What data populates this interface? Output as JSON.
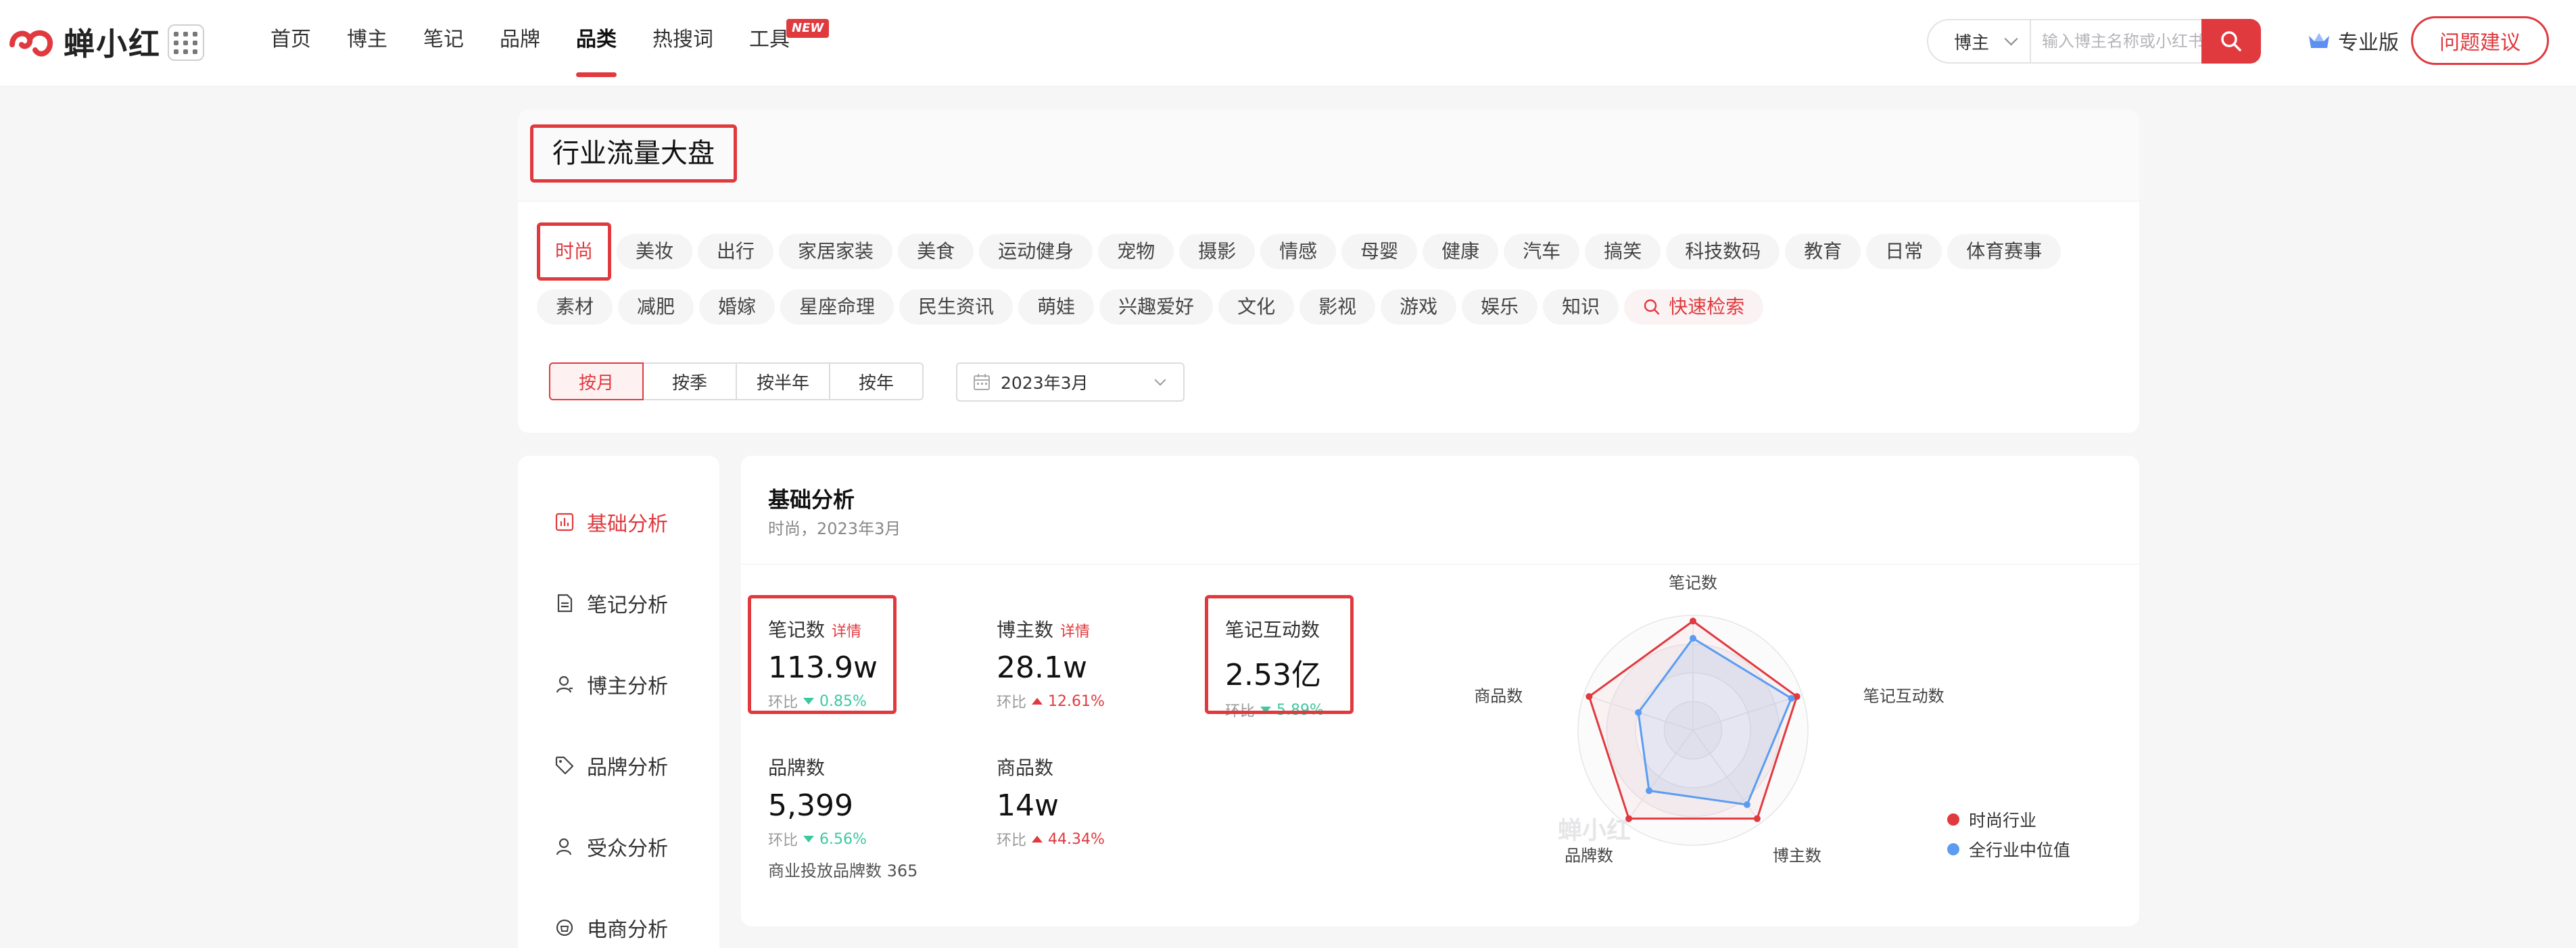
{
  "brand": {
    "name": "蝉小红"
  },
  "nav": [
    {
      "label": "首页"
    },
    {
      "label": "博主"
    },
    {
      "label": "笔记"
    },
    {
      "label": "品牌"
    },
    {
      "label": "品类"
    },
    {
      "label": "热搜词"
    },
    {
      "label": "工具"
    }
  ],
  "nav_badge": "NEW",
  "search": {
    "select_value": "博主",
    "placeholder": "输入博主名称或小红书号"
  },
  "pro_label": "专业版",
  "feedback_label": "问题建议",
  "page_title": "行业流量大盘",
  "categories_row1": [
    "时尚",
    "美妆",
    "出行",
    "家居家装",
    "美食",
    "运动健身",
    "宠物",
    "摄影",
    "情感",
    "母婴",
    "健康",
    "汽车",
    "搞笑",
    "科技数码",
    "教育",
    "日常",
    "体育赛事"
  ],
  "categories_row2": [
    "素材",
    "减肥",
    "婚嫁",
    "星座命理",
    "民生资讯",
    "萌娃",
    "兴趣爱好",
    "文化",
    "影视",
    "游戏",
    "娱乐",
    "知识"
  ],
  "quick_search_label": "快速检索",
  "period_tabs": [
    "按月",
    "按季",
    "按半年",
    "按年"
  ],
  "date_value": "2023年3月",
  "sidebar": [
    {
      "label": "基础分析",
      "icon": "bar-chart-icon"
    },
    {
      "label": "笔记分析",
      "icon": "document-icon"
    },
    {
      "label": "博主分析",
      "icon": "user-icon"
    },
    {
      "label": "品牌分析",
      "icon": "tag-icon"
    },
    {
      "label": "受众分析",
      "icon": "audience-icon"
    },
    {
      "label": "电商分析",
      "icon": "shop-icon"
    }
  ],
  "main": {
    "title": "基础分析",
    "subtitle": "时尚，2023年3月"
  },
  "stats": [
    {
      "label": "笔记数",
      "detail": "详情",
      "value": "113.9w",
      "change_prefix": "环比",
      "change": "0.85%",
      "direction": "down"
    },
    {
      "label": "博主数",
      "detail": "详情",
      "value": "28.1w",
      "change_prefix": "环比",
      "change": "12.61%",
      "direction": "up"
    },
    {
      "label": "笔记互动数",
      "detail": "",
      "value": "2.53亿",
      "change_prefix": "环比",
      "change": "5.89%",
      "direction": "down"
    },
    {
      "label": "品牌数",
      "detail": "",
      "value": "5,399",
      "change_prefix": "环比",
      "change": "6.56%",
      "direction": "down"
    },
    {
      "label": "商品数",
      "detail": "",
      "value": "14w",
      "change_prefix": "环比",
      "change": "44.34%",
      "direction": "up"
    }
  ],
  "brand_invest": "商业投放品牌数 365",
  "chart_data": {
    "type": "radar",
    "axes": [
      "笔记数",
      "笔记互动数",
      "博主数",
      "品牌数",
      "商品数"
    ],
    "series": [
      {
        "name": "时尚行业",
        "values": [
          0.95,
          0.95,
          0.95,
          0.95,
          0.95
        ],
        "color": "#e0393e"
      },
      {
        "name": "全行业中位值",
        "values": [
          0.8,
          0.9,
          0.8,
          0.65,
          0.5
        ],
        "color": "#5b9cf2"
      }
    ],
    "watermark": "蝉小红"
  }
}
